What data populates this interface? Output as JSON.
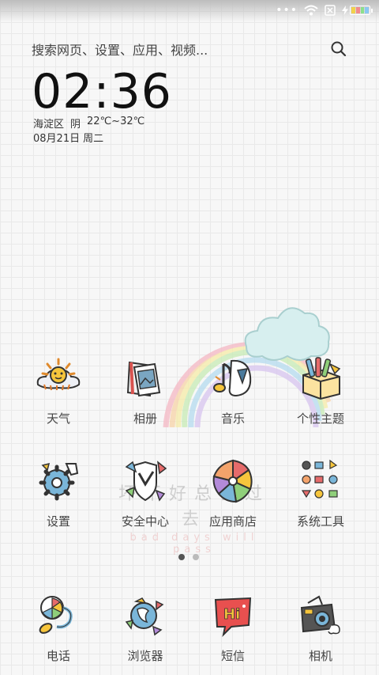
{
  "search": {
    "placeholder": "搜索网页、设置、应用、视频..."
  },
  "clock": {
    "time": "02:36"
  },
  "weather": {
    "location": "海淀区",
    "condition": "阴",
    "temperature": "22℃~32℃"
  },
  "date": {
    "date": "08月21日",
    "weekday": "周二"
  },
  "watermark": {
    "cn": "坏不好总会过去",
    "en": "bad days will pass"
  },
  "apps_row1": [
    {
      "label": "天气",
      "icon": "weather-sun-cloud-icon"
    },
    {
      "label": "相册",
      "icon": "photo-album-icon"
    },
    {
      "label": "音乐",
      "icon": "music-note-icon"
    },
    {
      "label": "个性主题",
      "icon": "theme-paint-box-icon"
    }
  ],
  "apps_row2": [
    {
      "label": "设置",
      "icon": "settings-gear-icon"
    },
    {
      "label": "安全中心",
      "icon": "security-shield-icon"
    },
    {
      "label": "应用商店",
      "icon": "app-store-pinwheel-icon"
    },
    {
      "label": "系统工具",
      "icon": "system-tools-grid-icon"
    }
  ],
  "dock": [
    {
      "label": "电话",
      "icon": "phone-icon"
    },
    {
      "label": "浏览器",
      "icon": "browser-icon"
    },
    {
      "label": "短信",
      "icon": "sms-hi-bubble-icon"
    },
    {
      "label": "相机",
      "icon": "camera-icon"
    }
  ],
  "pager": {
    "pages": 2,
    "active": 1
  },
  "colors": {
    "grid_bg": "#f7f7f7",
    "grid_line": "#e9e9e9",
    "text": "#444444",
    "pager_active": "#555555",
    "pager_inactive": "#bbbbbb"
  }
}
